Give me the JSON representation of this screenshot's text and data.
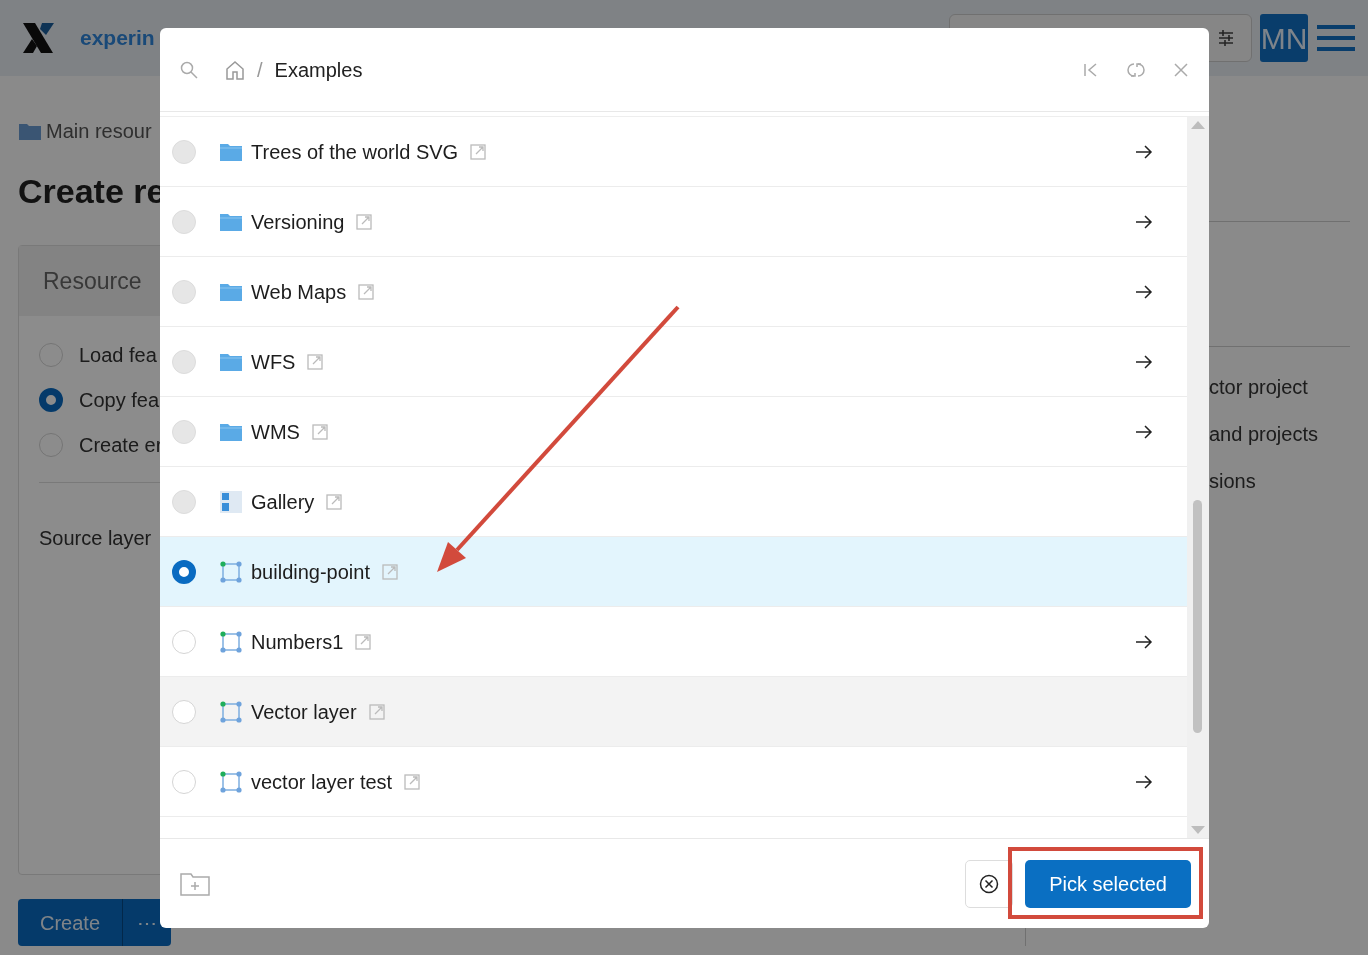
{
  "app_header": {
    "logo_text": "experin",
    "avatar": "MN"
  },
  "background_page": {
    "breadcrumb": "Main resour",
    "heading": "Create re",
    "card_title": "Resource",
    "options": [
      {
        "label": "Load fea",
        "selected": false
      },
      {
        "label": "Copy fea",
        "selected": true
      },
      {
        "label": "Create er",
        "selected": false
      }
    ],
    "source_label": "Source layer",
    "create_button": "Create",
    "more_button": "⋯",
    "side_links": [
      "ctor project",
      "and projects",
      "sions"
    ]
  },
  "dialog": {
    "separator": "/",
    "path": "Examples",
    "items": [
      {
        "name": "Trees of the world SVG",
        "kind": "folder",
        "selected": false,
        "disabled": true,
        "navigable": true,
        "hovered": false
      },
      {
        "name": "Versioning",
        "kind": "folder",
        "selected": false,
        "disabled": true,
        "navigable": true,
        "hovered": false
      },
      {
        "name": "Web Maps",
        "kind": "folder",
        "selected": false,
        "disabled": true,
        "navigable": true,
        "hovered": false
      },
      {
        "name": "WFS",
        "kind": "folder",
        "selected": false,
        "disabled": true,
        "navigable": true,
        "hovered": false
      },
      {
        "name": "WMS",
        "kind": "folder",
        "selected": false,
        "disabled": true,
        "navigable": true,
        "hovered": false
      },
      {
        "name": "Gallery",
        "kind": "gallery",
        "selected": false,
        "disabled": true,
        "navigable": false,
        "hovered": false
      },
      {
        "name": "building-point",
        "kind": "vector_layer",
        "selected": true,
        "disabled": false,
        "navigable": false,
        "hovered": false
      },
      {
        "name": "Numbers1",
        "kind": "vector_layer",
        "selected": false,
        "disabled": false,
        "navigable": true,
        "hovered": false
      },
      {
        "name": "Vector layer",
        "kind": "vector_layer",
        "selected": false,
        "disabled": false,
        "navigable": false,
        "hovered": true
      },
      {
        "name": "vector layer test",
        "kind": "vector_layer",
        "selected": false,
        "disabled": false,
        "navigable": true,
        "hovered": false
      }
    ],
    "pick_button": "Pick selected"
  },
  "annotations": {
    "arrow_to_selection": true,
    "pick_button_highlight": true
  }
}
